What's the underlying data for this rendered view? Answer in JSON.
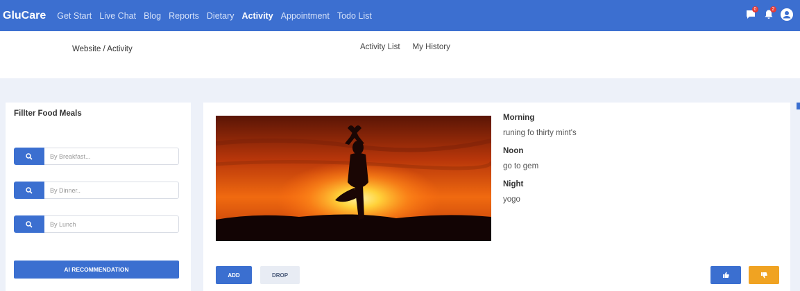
{
  "navbar": {
    "brand": "GluCare",
    "links": [
      {
        "label": "Get Start",
        "active": false
      },
      {
        "label": "Live Chat",
        "active": false
      },
      {
        "label": "Blog",
        "active": false
      },
      {
        "label": "Reports",
        "active": false
      },
      {
        "label": "Dietary",
        "active": false
      },
      {
        "label": "Activity",
        "active": true
      },
      {
        "label": "Appointment",
        "active": false
      },
      {
        "label": "Todo List",
        "active": false
      }
    ],
    "icons": [
      {
        "name": "chat-icon",
        "badge": "0"
      },
      {
        "name": "bell-icon",
        "badge": "2"
      },
      {
        "name": "user-icon"
      }
    ]
  },
  "breadcrumb": "Website / Activity",
  "subtabs": [
    "Activity List",
    "My History"
  ],
  "filter": {
    "title": "Fillter Food Meals",
    "inputs": [
      {
        "placeholder": "By Breakfast..."
      },
      {
        "placeholder": "By Dinner.."
      },
      {
        "placeholder": "By Lunch"
      }
    ],
    "ai_button": "AI RECOMMENDATION"
  },
  "activity": {
    "morning_label": "Morning",
    "morning_value": "runing fo thirty mint's",
    "noon_label": "Noon",
    "noon_value": "go to gem",
    "night_label": "Night",
    "night_value": "yogo"
  },
  "buttons": {
    "add": "ADD",
    "drop": "DROP"
  },
  "colors": {
    "primary": "#3b6fd0",
    "navbar": "#3c6fd0",
    "warning": "#f0a322",
    "badge": "#e53935"
  }
}
